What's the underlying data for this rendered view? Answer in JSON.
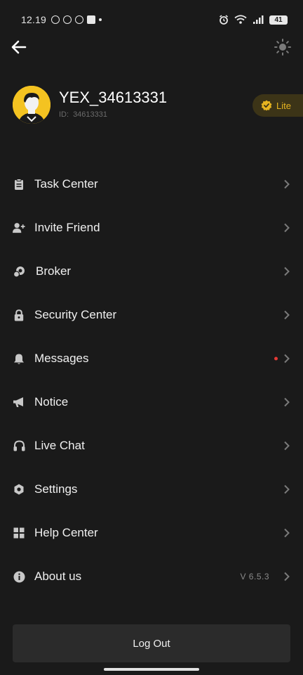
{
  "status_bar": {
    "time": "12.19",
    "battery": "41"
  },
  "nav": {
    "back_icon": "arrow-left-icon",
    "theme_icon": "sun-icon"
  },
  "profile": {
    "username": "YEX_34613331",
    "id_label": "ID:",
    "id_value": "34613331",
    "level": "Lite",
    "avatar_color": "#f4c321",
    "badge_color": "#e6b420"
  },
  "menu": {
    "items": [
      {
        "label": "Task Center",
        "icon": "clipboard-icon"
      },
      {
        "label": "Invite Friend",
        "icon": "add-user-icon"
      },
      {
        "label": "Broker",
        "icon": "broker-icon"
      },
      {
        "label": "Security Center",
        "icon": "lock-icon"
      },
      {
        "label": "Messages",
        "icon": "bell-icon",
        "unread": true
      },
      {
        "label": "Notice",
        "icon": "megaphone-icon"
      },
      {
        "label": "Live Chat",
        "icon": "headphones-icon"
      },
      {
        "label": "Settings",
        "icon": "gear-icon"
      },
      {
        "label": "Help Center",
        "icon": "grid-icon"
      },
      {
        "label": "About us",
        "icon": "info-icon",
        "version": "V 6.5.3"
      }
    ]
  },
  "logout_label": "Log Out",
  "colors": {
    "background": "#1a1a1a",
    "accent": "#e6b420",
    "unread_dot": "#e53935"
  }
}
